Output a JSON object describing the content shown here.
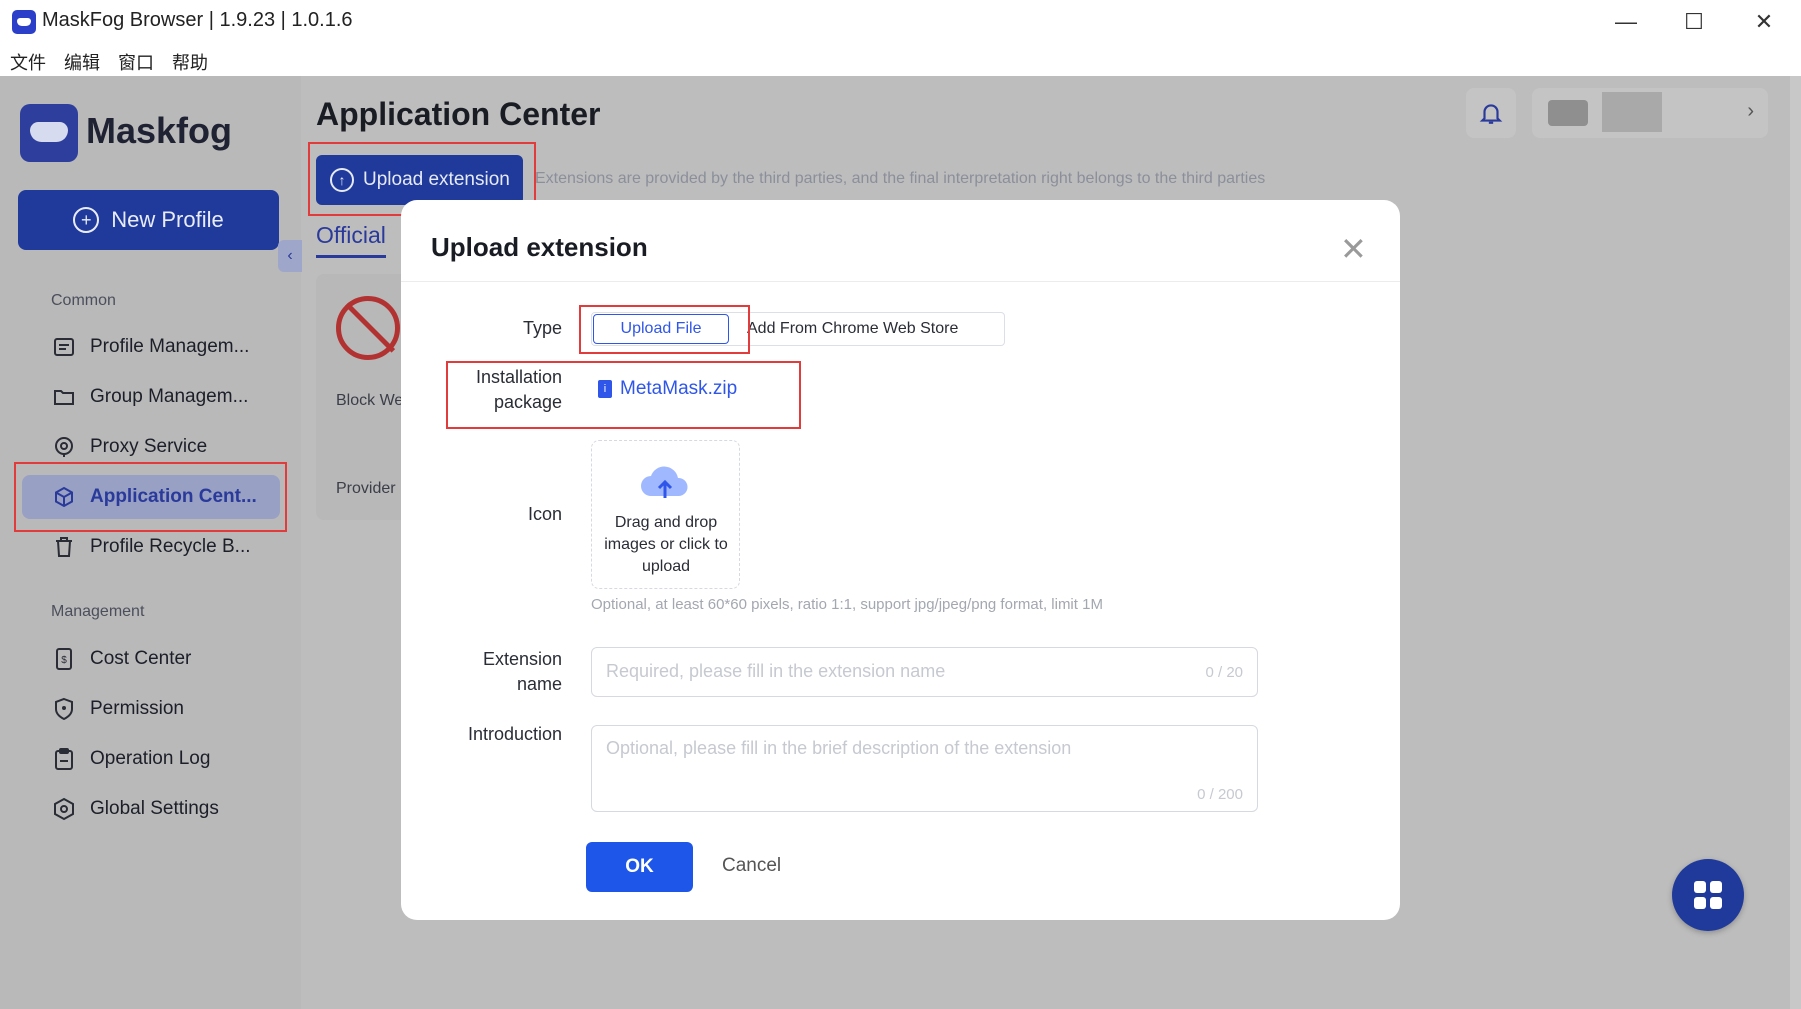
{
  "window": {
    "title": "MaskFog Browser | 1.9.23 | 1.0.1.6",
    "menu": [
      "文件",
      "编辑",
      "窗口",
      "帮助"
    ]
  },
  "sidebar": {
    "brand": "Maskfog",
    "new_profile": "New Profile",
    "common_label": "Common",
    "common_items": [
      {
        "label": "Profile Managem...",
        "icon": "profile-icon"
      },
      {
        "label": "Group Managem...",
        "icon": "folder-icon"
      },
      {
        "label": "Proxy Service",
        "icon": "location-icon"
      },
      {
        "label": "Application Cent...",
        "icon": "cube-icon",
        "active": true
      },
      {
        "label": "Profile Recycle B...",
        "icon": "trash-icon"
      }
    ],
    "management_label": "Management",
    "management_items": [
      {
        "label": "Cost Center",
        "icon": "receipt-icon"
      },
      {
        "label": "Permission",
        "icon": "shield-icon"
      },
      {
        "label": "Operation Log",
        "icon": "clipboard-icon"
      },
      {
        "label": "Global Settings",
        "icon": "hexagon-gear-icon"
      }
    ]
  },
  "main": {
    "title": "Application Center",
    "upload_button": "Upload extension",
    "notice": "Extensions are provided by the third parties, and the final interpretation right belongs to the third parties",
    "tab_official": "Official",
    "card_name": "Block We",
    "card_provider": "Provider"
  },
  "modal": {
    "title": "Upload extension",
    "type_label": "Type",
    "type_options": [
      "Upload File",
      "Add From Chrome Web Store"
    ],
    "type_selected": "Upload File",
    "package_label_1": "Installation",
    "package_label_2": "package",
    "package_file": "MetaMask.zip",
    "icon_label": "Icon",
    "drop_text": "Drag and drop images or click to upload",
    "icon_hint": "Optional, at least 60*60 pixels, ratio 1:1, support jpg/jpeg/png format, limit 1M",
    "name_label_1": "Extension",
    "name_label_2": "name",
    "name_placeholder": "Required, please fill in the extension name",
    "name_count": "0 / 20",
    "intro_label": "Introduction",
    "intro_placeholder": "Optional, please fill in the brief description of the extension",
    "intro_count": "0 / 200",
    "ok": "OK",
    "cancel": "Cancel"
  },
  "colors": {
    "brand": "#2f56e8",
    "highlight": "#e23b3b",
    "overlay_sidebar": "#b9b9b9"
  }
}
